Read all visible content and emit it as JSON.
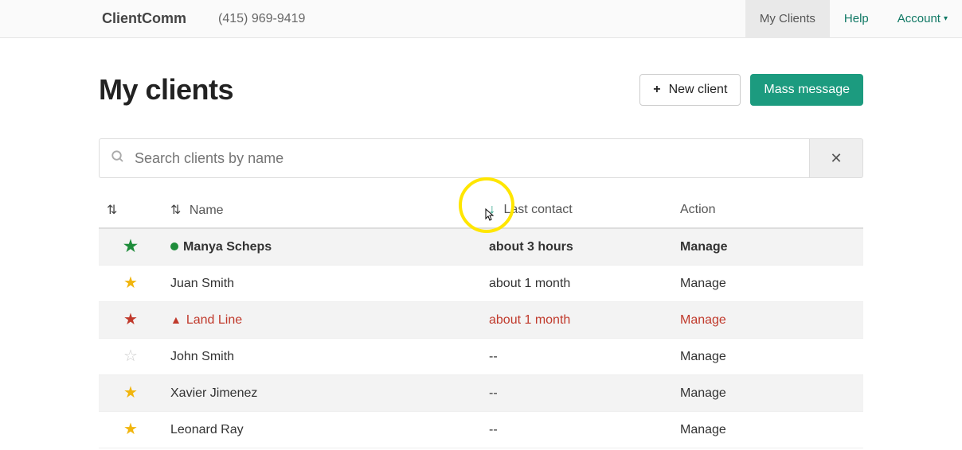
{
  "header": {
    "brand": "ClientComm",
    "phone": "(415) 969-9419",
    "nav": {
      "my_clients": "My Clients",
      "help": "Help",
      "account": "Account"
    }
  },
  "page": {
    "title": "My clients",
    "new_client": "New client",
    "mass_message": "Mass message"
  },
  "search": {
    "placeholder": "Search clients by name"
  },
  "table": {
    "col_name": "Name",
    "col_last": "Last contact",
    "col_action": "Action"
  },
  "rows": [
    {
      "star": "green",
      "indicator": "dot",
      "name": "Manya Scheps",
      "last": "about 3 hours",
      "action": "Manage",
      "bold": true,
      "zebra": true,
      "alert": false
    },
    {
      "star": "gold",
      "indicator": "",
      "name": "Juan Smith",
      "last": "about 1 month",
      "action": "Manage",
      "bold": false,
      "zebra": false,
      "alert": false
    },
    {
      "star": "red",
      "indicator": "warn",
      "name": "Land Line",
      "last": "about 1 month",
      "action": "Manage",
      "bold": false,
      "zebra": true,
      "alert": true
    },
    {
      "star": "empty",
      "indicator": "",
      "name": "John Smith",
      "last": "--",
      "action": "Manage",
      "bold": false,
      "zebra": false,
      "alert": false
    },
    {
      "star": "gold",
      "indicator": "",
      "name": "Xavier Jimenez",
      "last": "--",
      "action": "Manage",
      "bold": false,
      "zebra": true,
      "alert": false
    },
    {
      "star": "gold",
      "indicator": "",
      "name": "Leonard Ray",
      "last": "--",
      "action": "Manage",
      "bold": false,
      "zebra": false,
      "alert": false
    }
  ]
}
